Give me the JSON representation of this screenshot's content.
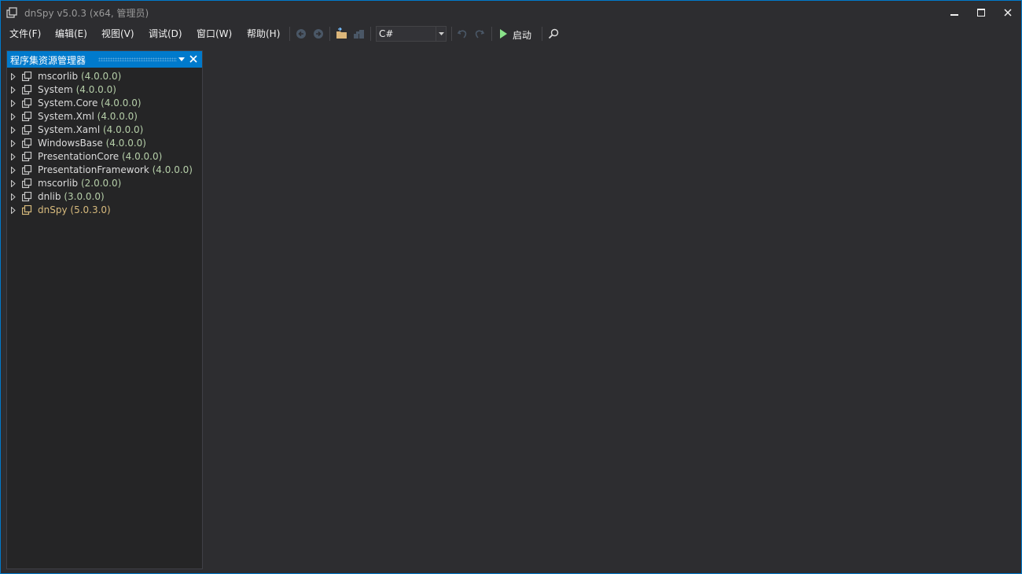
{
  "window": {
    "title": "dnSpy v5.0.3 (x64, 管理员)",
    "accent_color": "#007acc",
    "background_color": "#2d2d30"
  },
  "menubar": {
    "items": [
      {
        "label": "文件(F)"
      },
      {
        "label": "编辑(E)"
      },
      {
        "label": "视图(V)"
      },
      {
        "label": "调试(D)"
      },
      {
        "label": "窗口(W)"
      },
      {
        "label": "帮助(H)"
      }
    ]
  },
  "toolbar": {
    "icons": [
      "back-icon",
      "forward-icon",
      "open-icon",
      "open-list-icon",
      "undo-icon",
      "redo-icon",
      "start-icon",
      "search-icon"
    ],
    "language_selected": "C#",
    "start_label": "启动"
  },
  "assembly_explorer": {
    "title": "程序集资源管理器",
    "items": [
      {
        "name": "mscorlib",
        "version": "(4.0.0.0)"
      },
      {
        "name": "System",
        "version": "(4.0.0.0)"
      },
      {
        "name": "System.Core",
        "version": "(4.0.0.0)"
      },
      {
        "name": "System.Xml",
        "version": "(4.0.0.0)"
      },
      {
        "name": "System.Xaml",
        "version": "(4.0.0.0)"
      },
      {
        "name": "WindowsBase",
        "version": "(4.0.0.0)"
      },
      {
        "name": "PresentationCore",
        "version": "(4.0.0.0)"
      },
      {
        "name": "PresentationFramework",
        "version": "(4.0.0.0)"
      },
      {
        "name": "mscorlib",
        "version": "(2.0.0.0)"
      },
      {
        "name": "dnlib",
        "version": "(3.0.0.0)"
      },
      {
        "name": "dnSpy",
        "version": "(5.0.3.0)"
      }
    ]
  }
}
